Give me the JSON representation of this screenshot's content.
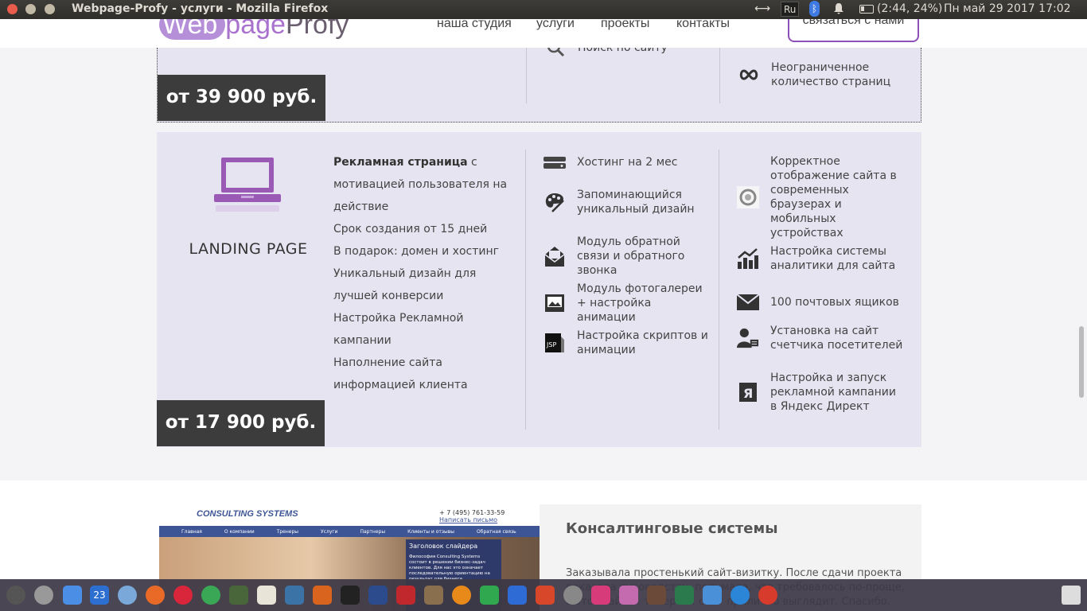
{
  "window": {
    "title": "Webpage-Profy - услуги - Mozilla Firefox"
  },
  "tray": {
    "network": "⟷",
    "keyboard": "Ru",
    "bluetooth": "ᛒ",
    "bell": "🔔",
    "battery": "(2:44, 24%)",
    "clock": "Пн май 29 2017 17:02"
  },
  "header": {
    "logo": {
      "part1": "Web",
      "part2": "page",
      "part3": "Profy"
    },
    "nav": [
      "наша студия",
      "услуги",
      "проекты",
      "контакты"
    ],
    "contact_button": "связаться с нами"
  },
  "card_top": {
    "price": "от 39 900 руб.",
    "features": [
      {
        "icon": "search-icon",
        "text": "Поиск по сайту"
      },
      {
        "icon": "infinity-icon",
        "text": "Неограниченное количество страниц"
      }
    ]
  },
  "landing": {
    "title": "LANDING PAGE",
    "icon": "laptop-icon",
    "desc_bold": "Рекламная страница",
    "desc_rest": " с мотивацией пользователя на действие",
    "desc_items": [
      "Срок создания от 15 дней",
      "В подарок: домен и хостинг",
      "Уникальный дизайн для лучшей конверсии",
      "Настройка Рекламной кампании",
      "Наполнение сайта информацией клиента"
    ],
    "price": "от 17 900 руб.",
    "features_col1": [
      {
        "icon": "server-icon",
        "text": "Хостинг на 2 мес"
      },
      {
        "icon": "palette-icon",
        "text": "Запоминающийся уникальный дизайн"
      },
      {
        "icon": "mail-open-icon",
        "text": "Модуль обратной связи и обратного звонка"
      },
      {
        "icon": "gallery-icon",
        "text": "Модуль фотогалереи + настройка анимации"
      },
      {
        "icon": "jsp-file-icon",
        "text": "Настройка скриптов и анимации"
      }
    ],
    "features_col2": [
      {
        "icon": "browser-icon",
        "text": "Корректное отображение сайта в современных браузерах и мобильных устройствах"
      },
      {
        "icon": "analytics-icon",
        "text": "Настройка системы аналитики для сайта"
      },
      {
        "icon": "envelope-icon",
        "text": "100 почтовых ящиков"
      },
      {
        "icon": "visitors-icon",
        "text": "Установка на сайт счетчика посетителей"
      },
      {
        "icon": "yandex-icon",
        "text": "Настройка и запуск рекламной кампании в Яндекс Директ"
      }
    ]
  },
  "project": {
    "title": "Консалтинговые системы",
    "text": "Заказывала простенький сайт-визитку. После сдачи проекта показала руководству, подумала, что требовалось по-проще, а этот сайт ... теперь ... сайт прилично выглядит. Спасибо.",
    "screenshot": {
      "logo": "CONSULTING SYSTEMS",
      "phone": "+ 7 (495) 761-33-59",
      "write_link": "Написать письмо",
      "nav": [
        "Главная",
        "О компании",
        "Тренеры",
        "Услуги",
        "Партнеры",
        "Клиенты и отзывы",
        "Обратная связь"
      ],
      "slider_title": "Заголовок слайдера",
      "slider_text": "Философия Consulting Systems состоит в решении бизнес-задач клиентов. Для нас это означает последовательную ориентацию на результат для бизнеса"
    }
  },
  "dock": {
    "calendar_day": "23",
    "apps": [
      "launcher-icon",
      "settings-icon",
      "finder-icon",
      "calendar-icon",
      "mail-icon",
      "firefox-icon",
      "opera-icon",
      "chrome-icon",
      "terminal-icon",
      "notes-icon",
      "python-icon",
      "fox-icon",
      "console-icon",
      "code-icon",
      "filezilla-icon",
      "gimp-icon",
      "blender-icon",
      "sheets-icon",
      "docs-icon",
      "slides-icon",
      "system-icon",
      "flower-icon",
      "video-icon",
      "calc-icon",
      "monitor-icon",
      "folder-icon",
      "download-icon",
      "upload-icon",
      "trash-icon"
    ]
  }
}
